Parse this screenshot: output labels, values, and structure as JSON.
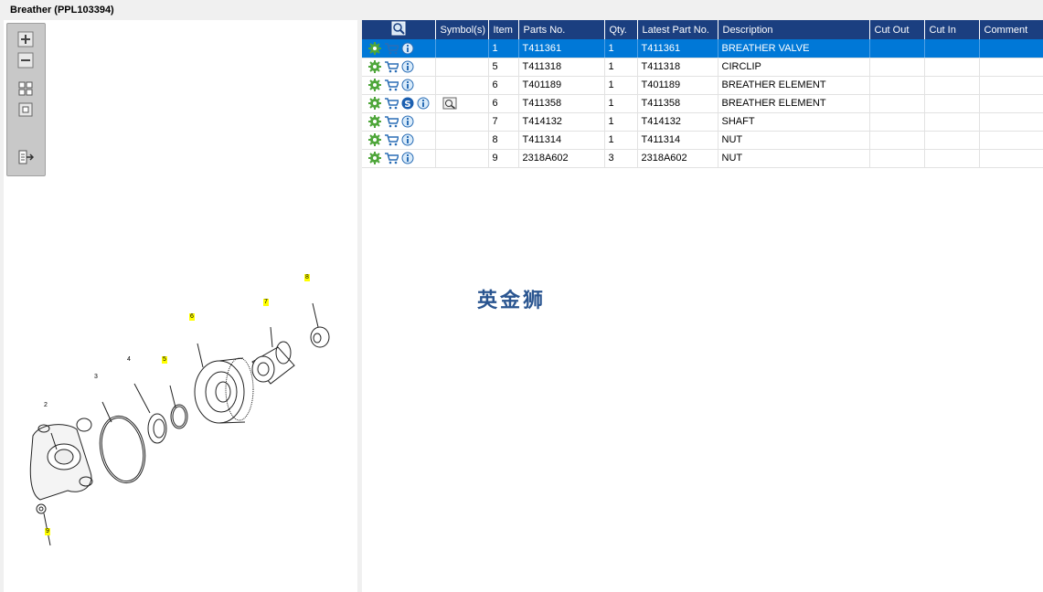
{
  "window": {
    "title": "Breather (PPL103394)"
  },
  "table": {
    "columns": [
      "",
      "Symbol(s)",
      "Item",
      "Parts No.",
      "Qty.",
      "Latest Part No.",
      "Description",
      "Cut Out",
      "Cut In",
      "Comment"
    ],
    "rows": [
      {
        "item": "1",
        "part_no": "T411361",
        "qty": "1",
        "latest": "T411361",
        "desc": "BREATHER VALVE",
        "selected": true
      },
      {
        "item": "5",
        "part_no": "T411318",
        "qty": "1",
        "latest": "T411318",
        "desc": "CIRCLIP"
      },
      {
        "item": "6",
        "part_no": "T401189",
        "qty": "1",
        "latest": "T401189",
        "desc": "BREATHER ELEMENT"
      },
      {
        "item": "6",
        "part_no": "T411358",
        "qty": "1",
        "latest": "T411358",
        "desc": "BREATHER ELEMENT",
        "has_s": true,
        "has_symbol": true
      },
      {
        "item": "7",
        "part_no": "T414132",
        "qty": "1",
        "latest": "T414132",
        "desc": "SHAFT"
      },
      {
        "item": "8",
        "part_no": "T411314",
        "qty": "1",
        "latest": "T411314",
        "desc": "NUT"
      },
      {
        "item": "9",
        "part_no": "2318A602",
        "qty": "3",
        "latest": "2318A602",
        "desc": "NUT"
      }
    ]
  },
  "watermark": "英金狮",
  "diagram": {
    "callouts": [
      {
        "label": "8",
        "hl": true
      },
      {
        "label": "7",
        "hl": true
      },
      {
        "label": "6",
        "hl": true
      },
      {
        "label": "5",
        "hl": true
      },
      {
        "label": "4",
        "hl": false
      },
      {
        "label": "3",
        "hl": false
      },
      {
        "label": "2",
        "hl": false
      },
      {
        "label": "9",
        "hl": true
      }
    ]
  },
  "colors": {
    "header": "#1b3f80",
    "selected": "#0078d7",
    "highlight": "#ffff00"
  }
}
